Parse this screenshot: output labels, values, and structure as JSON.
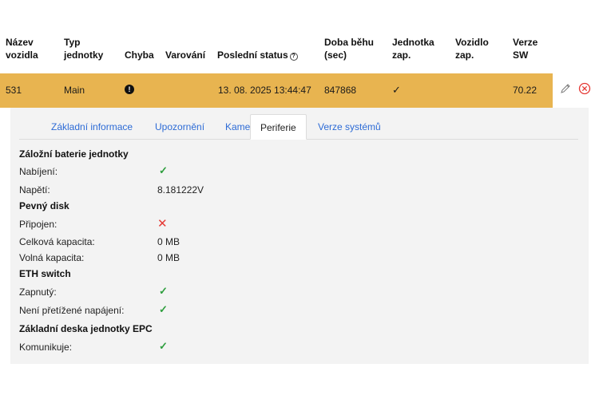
{
  "table": {
    "headers": {
      "vehicle_name_1": "Název",
      "vehicle_name_2": "vozidla",
      "unit_type_1": "Typ",
      "unit_type_2": "jednotky",
      "error": "Chyba",
      "warning": "Varování",
      "last_status": "Poslední status",
      "runtime_1": "Doba běhu",
      "runtime_2": "(sec)",
      "unit_on_1": "Jednotka",
      "unit_on_2": "zap.",
      "vehicle_on_1": "Vozidlo",
      "vehicle_on_2": "zap.",
      "sw_version_1": "Verze",
      "sw_version_2": "SW"
    },
    "row": {
      "vehicle_name": "531",
      "unit_type": "Main",
      "error_icon": "!",
      "last_status": "13. 08. 2025 13:44:47",
      "runtime": "847868",
      "unit_on_check": "✓",
      "sw_version": "70.22",
      "highlight_color": "#e8b450"
    }
  },
  "tabs": [
    {
      "label": "Základní informace",
      "active": false
    },
    {
      "label": "Upozornění",
      "active": false
    },
    {
      "label": "Kamery",
      "active": false
    },
    {
      "label": "Periferie",
      "active": true
    },
    {
      "label": "Verze systémů",
      "active": false
    }
  ],
  "peripherals": {
    "backup_battery": {
      "title": "Záložní baterie jednotky",
      "charging_label": "Nabíjení:",
      "charging_value": "✓",
      "voltage_label": "Napětí:",
      "voltage_value": "8.181222V"
    },
    "hard_disk": {
      "title": "Pevný disk",
      "connected_label": "Připojen:",
      "connected_value": "✕",
      "total_label": "Celková kapacita:",
      "total_value": "0 MB",
      "free_label": "Volná kapacita:",
      "free_value": "0 MB"
    },
    "eth_switch": {
      "title": "ETH switch",
      "on_label": "Zapnutý:",
      "on_value": "✓",
      "power_label": "Není přetížené napájení:",
      "power_value": "✓"
    },
    "epc_board": {
      "title": "Základní deska jednotky EPC",
      "comm_label": "Komunikuje:",
      "comm_value": "✓"
    }
  },
  "colors": {
    "ok": "#2e9e3e",
    "bad": "#e53935",
    "link": "#2d6bd6"
  },
  "icons": [
    "help-icon",
    "error-icon",
    "edit-icon",
    "delete-icon",
    "check-icon",
    "cross-icon"
  ]
}
